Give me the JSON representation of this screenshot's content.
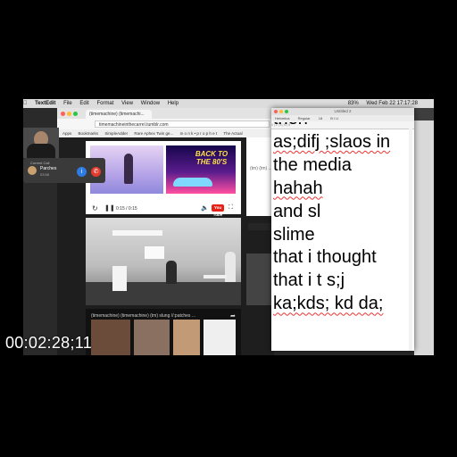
{
  "menubar": {
    "app_name": "TextEdit",
    "items": [
      "File",
      "Edit",
      "Format",
      "View",
      "Window",
      "Help"
    ],
    "clock": "Wed Feb 22  17:17:28",
    "battery": "83%"
  },
  "call": {
    "title": "Current Call",
    "caller_name": "Parches",
    "duration": "03:58",
    "info_glyph": "i",
    "end_glyph": "✆"
  },
  "browser": {
    "tab_title": "(timemachine) (timemachi...",
    "url": "timemachineinthecarrel.tumblr.com",
    "bookmarks": [
      "Apps",
      "Bookmarks",
      "SimpleAdder",
      "Rare Aphex Twin ge...",
      "m o n k • p r o p h e t",
      "The Actual"
    ],
    "video": {
      "thumb_text": "BACK TO THE 80'S",
      "time": "0:15 / 0:15",
      "logo": "You Tube"
    },
    "post_title": "(timemachine) (timemachine) (tm) slung //:patches ...",
    "side_label": "(tm) (tm) ..."
  },
  "editor": {
    "window_title": "Untitled 2",
    "toolbar": [
      "Helvetica",
      "Regular",
      "18",
      "B I U"
    ],
    "ruler": "0    |    2    |    4    |    6    |    8",
    "lines": [
      "then",
      "as;difj ;slaos in",
      "the media",
      "hahah",
      "and sl",
      "slime",
      "that i thought",
      "that i t s;j",
      "ka;kds;   kd  da;"
    ]
  },
  "timecode": "00:02:28;11",
  "colors": {
    "call_info": "#2d7be3",
    "call_end": "#e23b2e",
    "youtube_red": "#e62117",
    "spellcheck": "#ee3333"
  },
  "icons": {
    "replay": "replay-icon",
    "pause": "pause-icon",
    "volume": "volume-icon",
    "fullscreen": "fullscreen-icon",
    "share": "share-icon"
  }
}
